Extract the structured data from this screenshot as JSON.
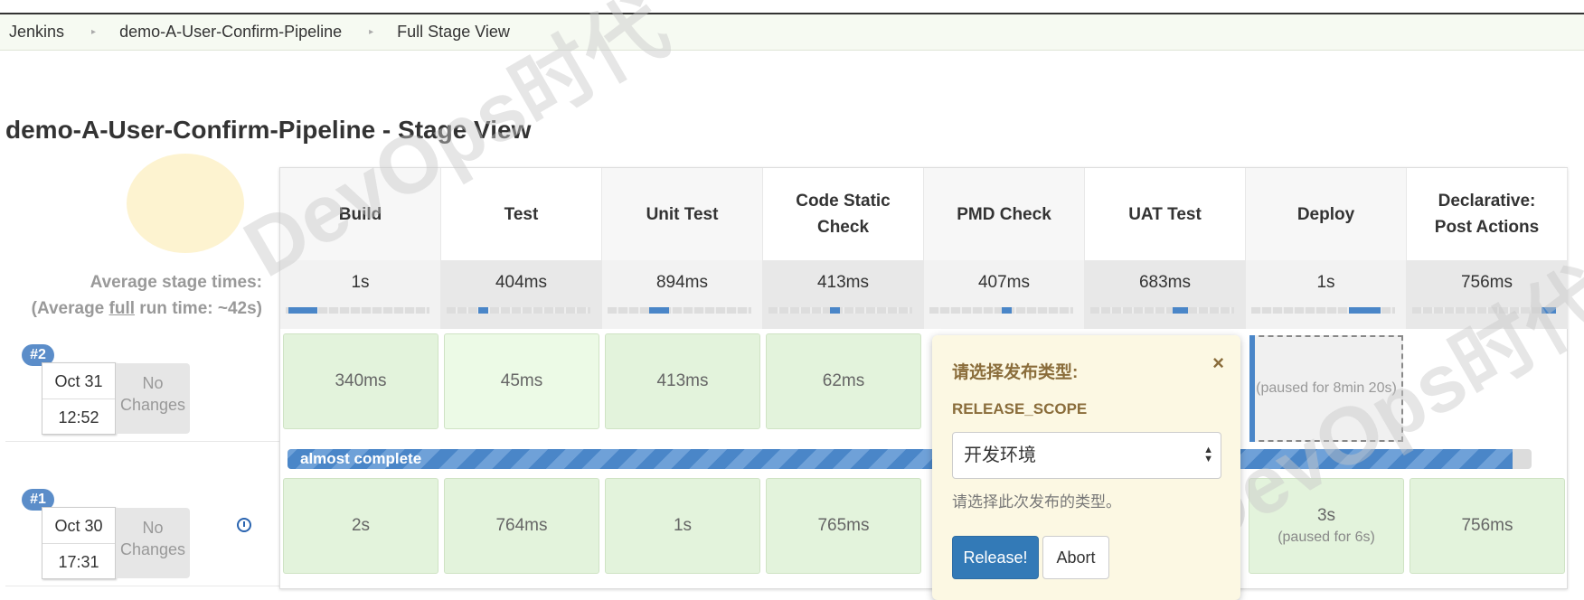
{
  "breadcrumb": {
    "items": [
      "Jenkins",
      "demo-A-User-Confirm-Pipeline",
      "Full Stage View"
    ],
    "separator": "▸"
  },
  "page_title": "demo-A-User-Confirm-Pipeline - Stage View",
  "average": {
    "line1": "Average stage times:",
    "line2_pre": "(Average ",
    "line2_u": "full",
    "line2_post": " run time: ~42s)"
  },
  "stages": [
    {
      "header_line1": "Build",
      "header_line2": "",
      "avg": "1s",
      "avg_bar": [
        0.02,
        0.22
      ],
      "run2": "340ms",
      "run1": "2s",
      "run1_sub": ""
    },
    {
      "header_line1": "Test",
      "header_line2": "",
      "avg": "404ms",
      "avg_bar": [
        0.22,
        0.29
      ],
      "run2": "45ms",
      "run1": "764ms",
      "run1_sub": ""
    },
    {
      "header_line1": "Unit Test",
      "header_line2": "",
      "avg": "894ms",
      "avg_bar": [
        0.29,
        0.43
      ],
      "run2": "413ms",
      "run1": "1s",
      "run1_sub": ""
    },
    {
      "header_line1": "Code Static",
      "header_line2": "Check",
      "avg": "413ms",
      "avg_bar": [
        0.43,
        0.5
      ],
      "run2": "62ms",
      "run1": "765ms",
      "run1_sub": ""
    },
    {
      "header_line1": "PMD Check",
      "header_line2": "",
      "avg": "407ms",
      "avg_bar": [
        0.5,
        0.57
      ],
      "run2": "",
      "run1": "",
      "run1_sub": ""
    },
    {
      "header_line1": "UAT Test",
      "header_line2": "",
      "avg": "683ms",
      "avg_bar": [
        0.57,
        0.68
      ],
      "run2": "",
      "run1": "",
      "run1_sub": ""
    },
    {
      "header_line1": "Deploy",
      "header_line2": "",
      "avg": "1s",
      "avg_bar": [
        0.68,
        0.9
      ],
      "run2": "",
      "run1": "3s",
      "run1_sub": "(paused for 6s)"
    },
    {
      "header_line1": "Declarative:",
      "header_line2": "Post Actions",
      "avg": "756ms",
      "avg_bar": [
        0.9,
        1.0
      ],
      "run2": "",
      "run1": "756ms",
      "run1_sub": ""
    }
  ],
  "runs": [
    {
      "badge": "#2",
      "date": "Oct 31",
      "time": "12:52",
      "changes": "No Changes"
    },
    {
      "badge": "#1",
      "date": "Oct 30",
      "time": "17:31",
      "changes": "No Changes"
    }
  ],
  "progress": {
    "label": "almost complete",
    "fraction": 0.985
  },
  "paused_cell": {
    "text": "(paused for 8min 20s)"
  },
  "popup": {
    "title": "请选择发布类型:",
    "close": "×",
    "param_name": "RELEASE_SCOPE",
    "selected": "开发环境",
    "help": "请选择此次发布的类型。",
    "release_label": "Release!",
    "abort_label": "Abort"
  },
  "watermark": "DevOps时代",
  "colors": {
    "accent": "#337ab7",
    "success": "#e3f3dc",
    "popup_bg": "#fcf8e3"
  }
}
